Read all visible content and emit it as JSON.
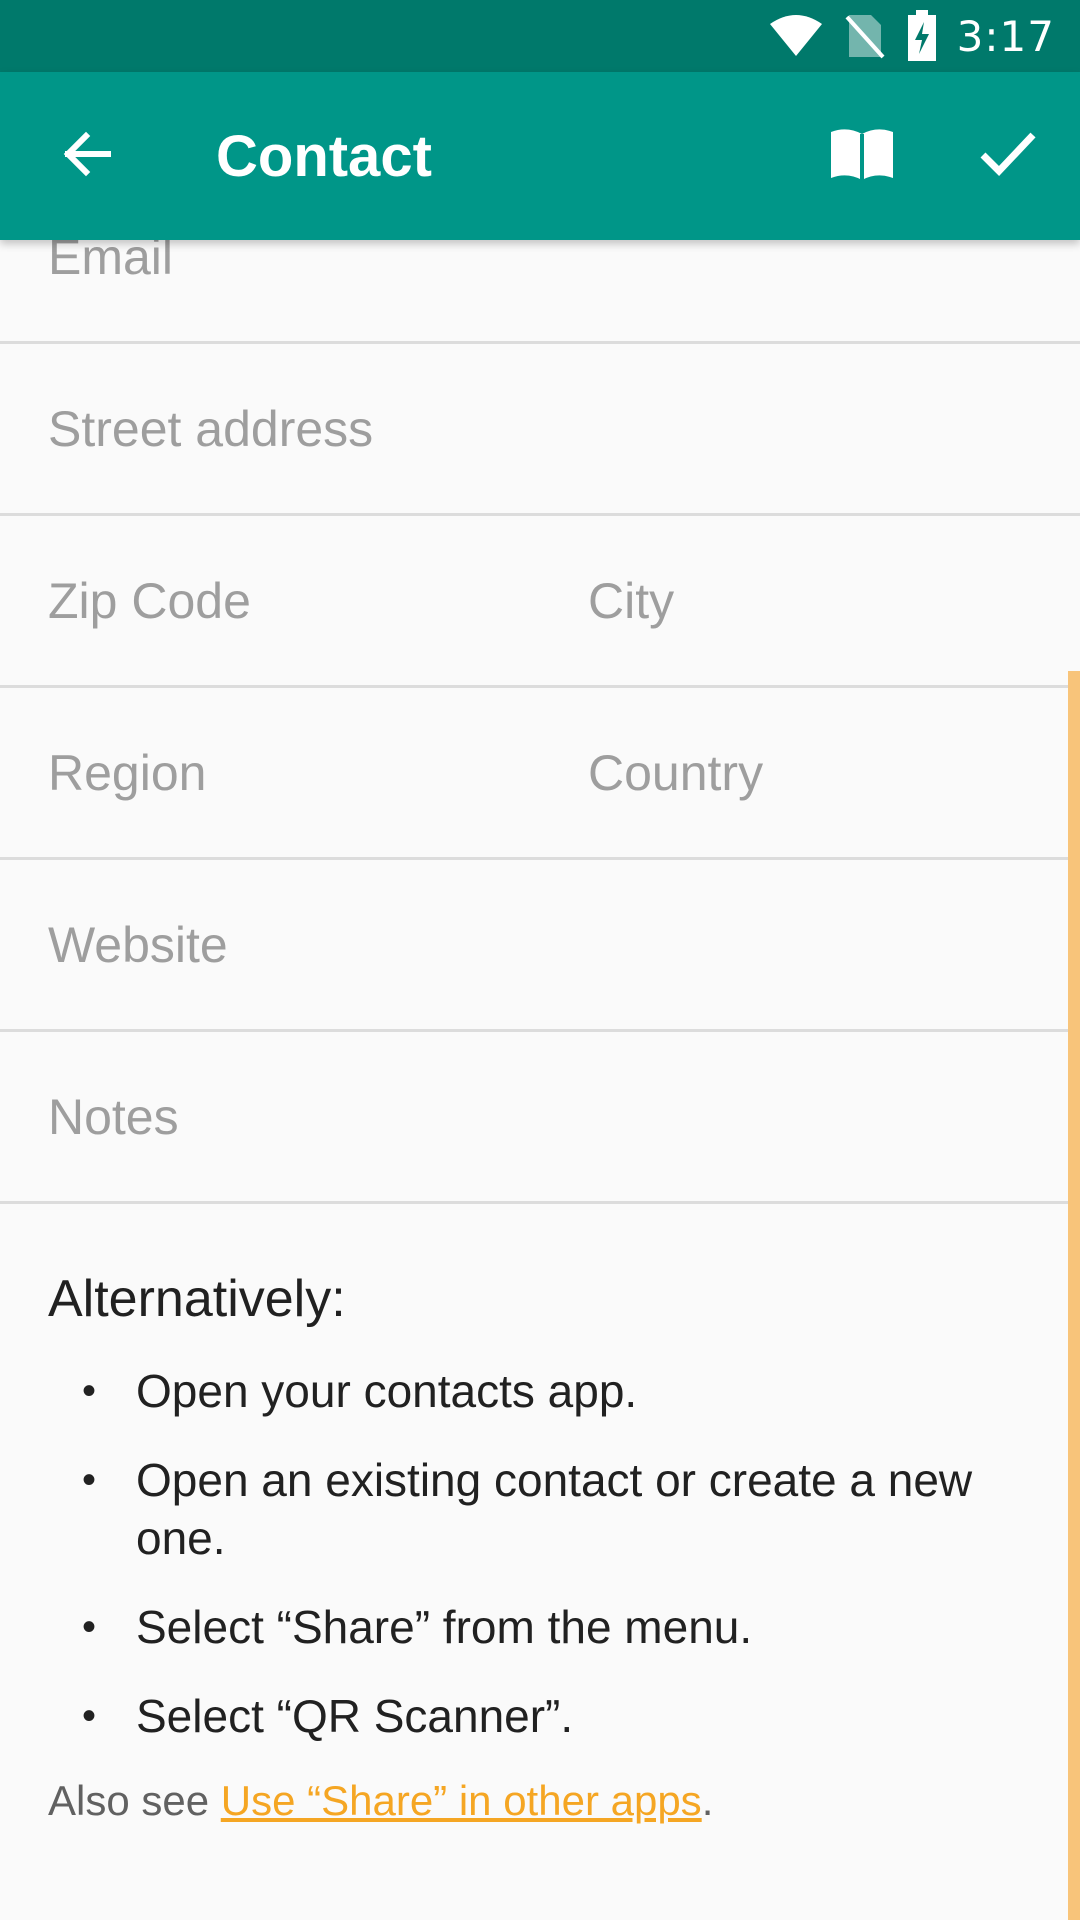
{
  "status_bar": {
    "time": "3:17",
    "icons": [
      "wifi-icon",
      "no-sim-icon",
      "battery-charging-icon"
    ]
  },
  "app_bar": {
    "title": "Contact",
    "back_icon": "arrow-left-icon",
    "actions": [
      {
        "name": "help-book-icon"
      },
      {
        "name": "check-icon"
      }
    ],
    "color": "#009688",
    "status_color": "#00796b"
  },
  "form": {
    "email_placeholder": "Email",
    "street_placeholder": "Street address",
    "zip_placeholder": "Zip Code",
    "city_placeholder": "City",
    "region_placeholder": "Region",
    "country_placeholder": "Country",
    "website_placeholder": "Website",
    "notes_placeholder": "Notes"
  },
  "help": {
    "heading": "Alternatively:",
    "steps": [
      "Open your contacts app.",
      "Open an existing contact or create a new one.",
      "Select “Share” from the menu.",
      "Select “QR Scanner”."
    ],
    "also_prefix": "Also see ",
    "also_link": "Use “Share” in other apps",
    "also_suffix": ".",
    "link_color": "#f5a623"
  }
}
